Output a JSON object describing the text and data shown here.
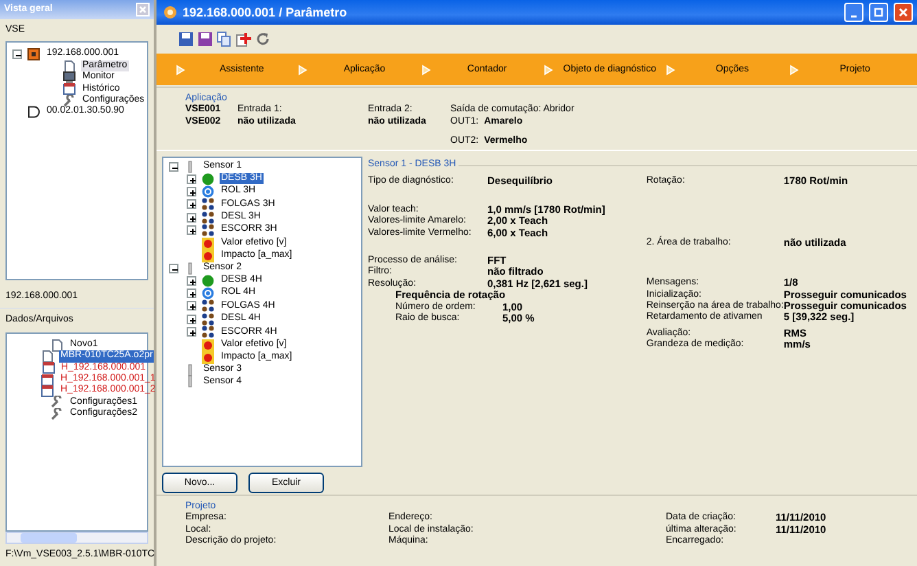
{
  "sidebar": {
    "title": "Vista geral",
    "root_label": "VSE",
    "tree": [
      {
        "label": "192.168.000.001",
        "kind": "device",
        "expanded": true,
        "children": [
          {
            "label": "Parâmetro",
            "kind": "document",
            "selected": true
          },
          {
            "label": "Monitor",
            "kind": "monitor",
            "selected": false
          },
          {
            "label": "Histórico",
            "kind": "history",
            "selected": false
          },
          {
            "label": "Configurações",
            "kind": "config",
            "selected": false
          }
        ]
      },
      {
        "label": "00.02.01.30.50.90",
        "kind": "module"
      }
    ],
    "status": "192.168.000.001",
    "files_title": "Dados/Arquivos",
    "files": [
      {
        "label": "Novo1",
        "kind": "document",
        "selected": false
      },
      {
        "label": "MBR-010TC25A.o2pr",
        "kind": "document",
        "selected": true
      },
      {
        "label": "H_192.168.000.001",
        "kind": "history",
        "selected": false
      },
      {
        "label": "H_192.168.000.001_1",
        "kind": "history",
        "selected": false
      },
      {
        "label": "H_192.168.000.001_2",
        "kind": "history",
        "selected": false
      },
      {
        "label": "Configurações1",
        "kind": "config",
        "selected": false
      },
      {
        "label": "Configurações2",
        "kind": "config",
        "selected": false
      }
    ],
    "path": "F:\\Vm_VSE003_2.5.1\\MBR-010TC"
  },
  "window": {
    "title": "192.168.000.001 / Parâmetro"
  },
  "steps": [
    "Assistente",
    "Aplicação",
    "Contador",
    "Objeto de diagnóstico",
    "Opções",
    "Projeto"
  ],
  "application": {
    "title": "Aplicação",
    "devices": [
      "VSE001",
      "VSE002"
    ],
    "inputs": [
      {
        "label": "Entrada 1:",
        "value": "não utilizada"
      },
      {
        "label": "Entrada 2:",
        "value": "não utilizada"
      }
    ],
    "switching": "Saída de comutação: Abridor",
    "outputs": [
      {
        "label": "OUT1:",
        "value": "Amarelo"
      },
      {
        "label": "OUT2:",
        "value": "Vermelho"
      }
    ]
  },
  "sensor_tree": [
    {
      "label": "Sensor 1",
      "expanded": true,
      "children": [
        {
          "label": "DESB 3H",
          "kind": "circle",
          "expanded": false,
          "selected": true
        },
        {
          "label": "ROL 3H",
          "kind": "ring",
          "expanded": false,
          "selected": false
        },
        {
          "label": "FOLGAS 3H",
          "kind": "cluster",
          "expanded": false,
          "selected": false
        },
        {
          "label": "DESL 3H",
          "kind": "cluster",
          "expanded": false,
          "selected": false
        },
        {
          "label": "ESCORR 3H",
          "kind": "cluster",
          "expanded": false,
          "selected": false
        },
        {
          "label": "Valor efetivo [v]",
          "kind": "value",
          "selected": false
        },
        {
          "label": "Impacto [a_max]",
          "kind": "value",
          "selected": false
        }
      ]
    },
    {
      "label": "Sensor 2",
      "expanded": true,
      "children": [
        {
          "label": "DESB 4H",
          "kind": "circle",
          "expanded": false,
          "selected": false
        },
        {
          "label": "ROL 4H",
          "kind": "ring",
          "expanded": false,
          "selected": false
        },
        {
          "label": "FOLGAS 4H",
          "kind": "cluster",
          "expanded": false,
          "selected": false
        },
        {
          "label": "DESL 4H",
          "kind": "cluster",
          "expanded": false,
          "selected": false
        },
        {
          "label": "ESCORR 4H",
          "kind": "cluster",
          "expanded": false,
          "selected": false
        },
        {
          "label": "Valor efetivo [v]",
          "kind": "value",
          "selected": false
        },
        {
          "label": "Impacto [a_max]",
          "kind": "value",
          "selected": false
        }
      ]
    },
    {
      "label": "Sensor 3"
    },
    {
      "label": "Sensor 4"
    }
  ],
  "buttons": [
    "Novo...",
    "Excluir"
  ],
  "details": {
    "title": "Sensor 1 - DESB 3H",
    "left": [
      [
        {
          "kind": "row",
          "label": "Tipo de diagnóstico:",
          "value": "Desequilíbrio"
        }
      ],
      [
        {
          "kind": "row",
          "label": "Valor teach:",
          "value": "1,0 mm/s [1780 Rot/min]"
        },
        {
          "kind": "row",
          "label": "Valores-limite Amarelo:",
          "value": "2,00 x Teach"
        },
        {
          "kind": "row",
          "label": "Valores-limite Vermelho:",
          "value": "6,00 x Teach"
        }
      ],
      [
        {
          "kind": "row",
          "label": "Processo de análise:",
          "value": "FFT"
        },
        {
          "kind": "row",
          "label": "Filtro:",
          "value": "não filtrado"
        },
        {
          "kind": "row",
          "label": "Resolução:",
          "value": "0,381 Hz [2,621 seg.]"
        },
        {
          "kind": "heading",
          "label": "Frequência de rotação"
        },
        {
          "kind": "sub",
          "label": "Número de ordem:",
          "value": "1,00"
        },
        {
          "kind": "sub",
          "label": "Raio de busca:",
          "value": "5,00 %"
        }
      ]
    ],
    "right": [
      [
        {
          "kind": "row",
          "label": "Rotação:",
          "value": "1780 Rot/min"
        }
      ],
      [
        {
          "kind": "row",
          "label": "2. Área de trabalho:",
          "value": "não utilizada"
        }
      ],
      [
        {
          "kind": "row",
          "label": "Mensagens:",
          "value": "1/8"
        },
        {
          "kind": "row",
          "label": "Inicialização:",
          "value": "Prosseguir comunicados"
        },
        {
          "kind": "row",
          "label": "Reinserção na área de trabalho:",
          "value": "Prosseguir comunicados"
        },
        {
          "kind": "row",
          "label": "Retardamento de ativamen",
          "value": "5 [39,322 seg.]"
        }
      ],
      [
        {
          "kind": "row",
          "label": "Avaliação:",
          "value": "RMS"
        },
        {
          "kind": "row",
          "label": "Grandeza de medição:",
          "value": "mm/s"
        }
      ]
    ]
  },
  "project": {
    "title": "Projeto",
    "columns": [
      [
        {
          "label": "Empresa:"
        },
        {
          "label": "Local:"
        },
        {
          "label": "Descrição do projeto:"
        }
      ],
      [
        {
          "label": "Endereço:"
        },
        {
          "label": "Local de instalação:"
        },
        {
          "label": "Máquina:"
        }
      ],
      [
        {
          "label": "Data de criação:",
          "value": "11/11/2010"
        },
        {
          "label": "última alteração:",
          "value": "11/11/2010"
        },
        {
          "label": "Encarregado:"
        }
      ]
    ]
  }
}
